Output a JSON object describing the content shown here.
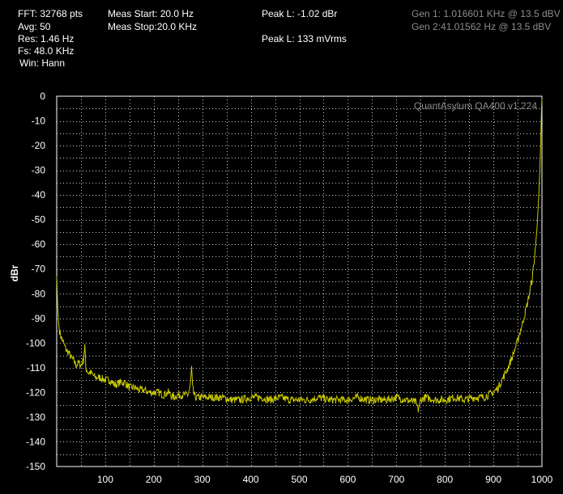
{
  "header": {
    "fft": "FFT: 32768 pts",
    "avg": "Avg: 50",
    "res": "Res: 1.46 Hz",
    "fs": "Fs: 48.0 KHz",
    "win": "Win: Hann",
    "meas_start": "Meas Start: 20.0 Hz",
    "meas_stop": "Meas Stop:20.0 KHz",
    "peak_l_dbr": "Peak L: -1.02 dBr",
    "peak_l_vrms": "Peak L: 133 mVrms",
    "gen1": "Gen 1: 1.016601 KHz @ 13.5 dBV",
    "gen2": "Gen 2:41.01562 Hz @ 13.5 dBV"
  },
  "colors": {
    "background": "#000000",
    "trace": "#c8c800",
    "grid": "#c8c8c8",
    "axis": "#ffffff",
    "generator_text": "#8c8c8c"
  },
  "chart_data": {
    "type": "line",
    "watermark": "QuantAsylum QA400 v1.224",
    "ylabel": "dBr",
    "xlim": [
      0,
      1000
    ],
    "ylim": [
      -150,
      0
    ],
    "xticks": [
      100,
      200,
      300,
      400,
      500,
      600,
      700,
      800,
      900,
      1000
    ],
    "yticks": [
      0,
      -10,
      -20,
      -30,
      -40,
      -50,
      -60,
      -70,
      -80,
      -90,
      -100,
      -110,
      -120,
      -130,
      -140,
      -150
    ],
    "grid": true,
    "series": [
      {
        "color": "#c8c800",
        "x": [
          0,
          2,
          4,
          6,
          8,
          12,
          16,
          20,
          25,
          30,
          35,
          40,
          45,
          50,
          55,
          58,
          60,
          65,
          70,
          80,
          90,
          100,
          110,
          120,
          130,
          140,
          150,
          160,
          170,
          180,
          190,
          200,
          210,
          220,
          230,
          240,
          250,
          260,
          270,
          275,
          278,
          280,
          283,
          286,
          290,
          300,
          320,
          340,
          360,
          380,
          400,
          420,
          440,
          460,
          480,
          500,
          520,
          540,
          560,
          580,
          600,
          620,
          640,
          660,
          680,
          700,
          720,
          740,
          745,
          750,
          760,
          780,
          800,
          820,
          840,
          860,
          880,
          900,
          910,
          920,
          930,
          940,
          950,
          960,
          970,
          980,
          985,
          990,
          993,
          996,
          998,
          999,
          1000
        ],
        "y": [
          -73,
          -85,
          -92,
          -95,
          -97,
          -99,
          -101,
          -103,
          -104,
          -106,
          -107,
          -109,
          -108,
          -109,
          -107,
          -101,
          -110,
          -112,
          -112,
          -114,
          -114,
          -115,
          -115,
          -117,
          -116,
          -116,
          -118,
          -118,
          -119,
          -119,
          -120,
          -120,
          -120,
          -121,
          -120,
          -122,
          -121,
          -121,
          -121,
          -118,
          -110,
          -118,
          -121,
          -122,
          -122,
          -122,
          -122,
          -122,
          -123,
          -123,
          -122,
          -122,
          -123,
          -122,
          -123,
          -123,
          -123,
          -122,
          -123,
          -123,
          -123,
          -122,
          -123,
          -123,
          -123,
          -122,
          -123,
          -124,
          -127,
          -123,
          -122,
          -123,
          -123,
          -122,
          -123,
          -122,
          -122,
          -120,
          -118,
          -114,
          -110,
          -105,
          -99,
          -92,
          -84,
          -74,
          -65,
          -53,
          -42,
          -28,
          -14,
          -6,
          -1
        ]
      }
    ]
  }
}
